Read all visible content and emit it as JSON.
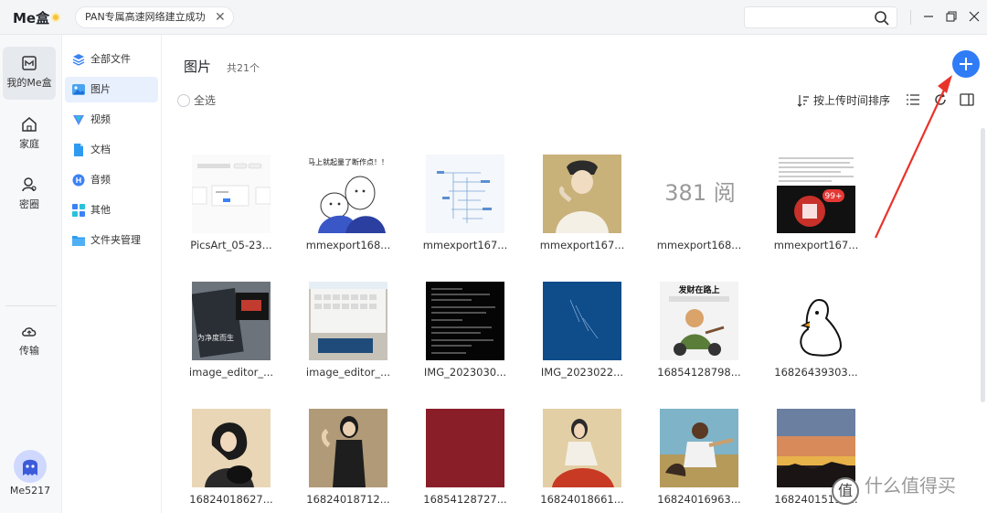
{
  "titlebar": {
    "brand": "Me盒",
    "toast": "PAN专属高速网络建立成功",
    "toast_close": "✕"
  },
  "rail": {
    "items": [
      {
        "label": "我的Me盒",
        "icon": "my-box-icon"
      },
      {
        "label": "家庭",
        "icon": "home-icon"
      },
      {
        "label": "密圈",
        "icon": "private-circle-icon"
      },
      {
        "label": "传输",
        "icon": "transfer-cloud-icon"
      }
    ],
    "user": "Me5217"
  },
  "categories": [
    {
      "label": "全部文件",
      "icon": "all-files-icon"
    },
    {
      "label": "图片",
      "icon": "image-icon"
    },
    {
      "label": "视频",
      "icon": "video-icon"
    },
    {
      "label": "文档",
      "icon": "document-icon"
    },
    {
      "label": "音频",
      "icon": "audio-icon"
    },
    {
      "label": "其他",
      "icon": "other-icon"
    },
    {
      "label": "文件夹管理",
      "icon": "folder-icon"
    }
  ],
  "main": {
    "title": "图片",
    "count": "共21个",
    "select_all": "全选",
    "sort_label": "按上传时间排序"
  },
  "files": [
    {
      "name": "PicsArt_05-23...",
      "thumb": "screenshot-white"
    },
    {
      "name": "mmexport168...",
      "thumb": "cartoon-blue",
      "text": "马上就起量了断作点！！"
    },
    {
      "name": "mmexport167...",
      "thumb": "mindmap"
    },
    {
      "name": "mmexport167...",
      "thumb": "painting-man"
    },
    {
      "name": "mmexport168...",
      "thumb": "gray-text",
      "text": "381 阅"
    },
    {
      "name": "mmexport167...",
      "thumb": "red-badge",
      "text": "99+"
    },
    {
      "name": "image_editor_...",
      "thumb": "dark-box",
      "text": "为净度而生"
    },
    {
      "name": "image_editor_...",
      "thumb": "keyboard"
    },
    {
      "name": "IMG_2023030...",
      "thumb": "black-text"
    },
    {
      "name": "IMG_2023022...",
      "thumb": "blue-book"
    },
    {
      "name": "16854128798...",
      "thumb": "meme-moto",
      "text": "发财在路上"
    },
    {
      "name": "16826439303...",
      "thumb": "duck"
    },
    {
      "name": "16824018627...",
      "thumb": "girl-cat"
    },
    {
      "name": "16824018712...",
      "thumb": "girl-dress"
    },
    {
      "name": "16854128727...",
      "thumb": "dark-red"
    },
    {
      "name": "16824018661...",
      "thumb": "girl-red"
    },
    {
      "name": "16824016963...",
      "thumb": "meme-fight"
    },
    {
      "name": "16824015193...",
      "thumb": "sunset"
    }
  ],
  "watermark": {
    "badge": "值",
    "text": "什么值得买"
  },
  "colors": {
    "accent": "#2f7cf6",
    "active_cat_bg": "#e8f0fe",
    "annotation_arrow": "#e8332a"
  }
}
